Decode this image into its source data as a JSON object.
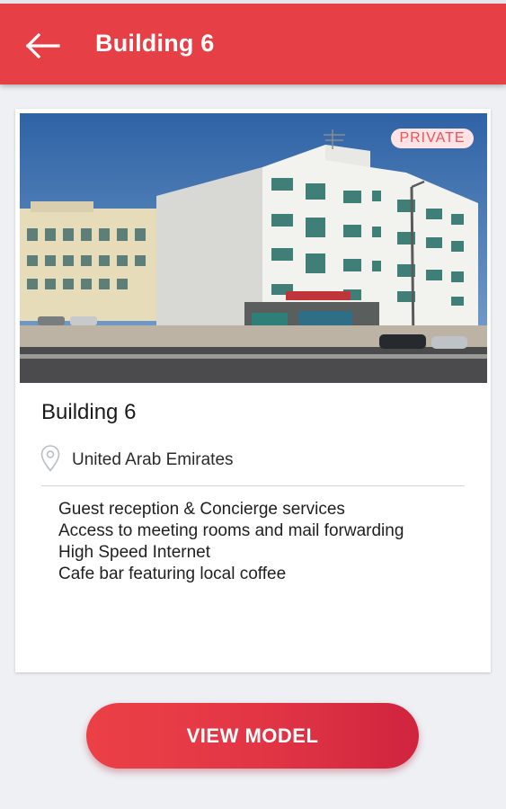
{
  "appbar": {
    "title": "Building 6",
    "back_icon": "arrow-left-icon",
    "color": "#e63f45"
  },
  "card": {
    "badge": "PRIVATE",
    "title": "Building 6",
    "location_icon": "map-pin-icon",
    "location": "United Arab Emirates",
    "features": [
      "Guest reception & Concierge services",
      "Access to meeting rooms and mail forwarding",
      "High Speed Internet",
      "Cafe bar featuring local coffee"
    ]
  },
  "cta": {
    "label": "VIEW MODEL",
    "color": "#e13545"
  }
}
